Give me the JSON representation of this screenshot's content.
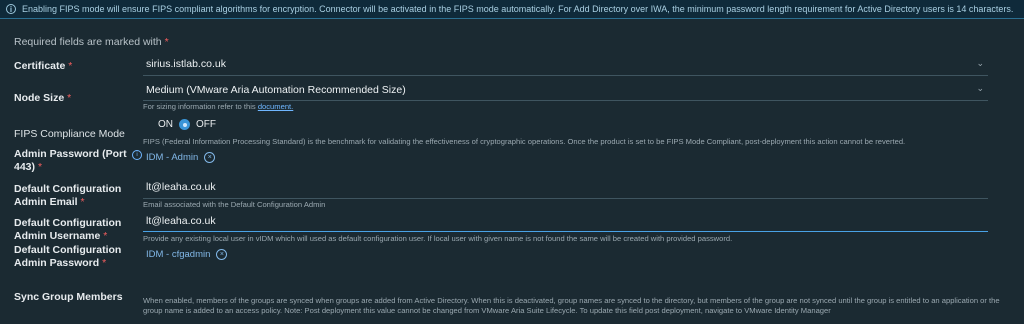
{
  "banner": {
    "icon": "info-icon",
    "text": "Enabling FIPS mode will ensure FIPS compliant algorithms for encryption. Connector will be activated in the FIPS mode automatically. For Add Directory over IWA, the minimum password length requirement for Active Directory users is 14 characters."
  },
  "form": {
    "required_note": "Required fields are marked with",
    "required_star": "*",
    "certificate": {
      "label": "Certificate",
      "value": "sirius.istlab.co.uk"
    },
    "node_size": {
      "label": "Node Size",
      "value": "Medium (VMware Aria Automation Recommended Size)",
      "help_prefix": "For sizing information refer to this",
      "help_link": "document."
    },
    "fips": {
      "label": "FIPS Compliance Mode",
      "on_label": "ON",
      "off_label": "OFF",
      "help": "FIPS (Federal Information Processing Standard) is the benchmark for validating the effectiveness of cryptographic operations. Once the product is set to be FIPS Mode Compliant, post-deployment this action cannot be reverted."
    },
    "admin_password": {
      "label_line1": "Admin Password (Port",
      "label_line2": "443)",
      "chip": "IDM - Admin"
    },
    "default_email": {
      "label_line1": "Default Configuration",
      "label_line2": "Admin Email",
      "value": "lt@leaha.co.uk",
      "help": "Email associated with the Default Configuration Admin"
    },
    "default_username": {
      "label_line1": "Default Configuration",
      "label_line2": "Admin Username",
      "value": "lt@leaha.co.uk",
      "help": "Provide any existing local user in vIDM which will used as default configuration user. If local user with given name is not found the same will be created with provided password."
    },
    "default_password": {
      "label_line1": "Default Configuration",
      "label_line2": "Admin Password",
      "chip": "IDM - cfgadmin"
    },
    "sync_group": {
      "label": "Sync Group Members",
      "help": "When enabled, members of the groups are synced when groups are added from Active Directory. When this is deactivated, group names are synced to the directory, but members of the group are not synced until the group is entitled to an application or the group name is added to an access policy. Note: Post deployment this value cannot be changed from VMware Aria Suite Lifecycle. To update this field post deployment, navigate to VMware Identity Manager"
    }
  }
}
